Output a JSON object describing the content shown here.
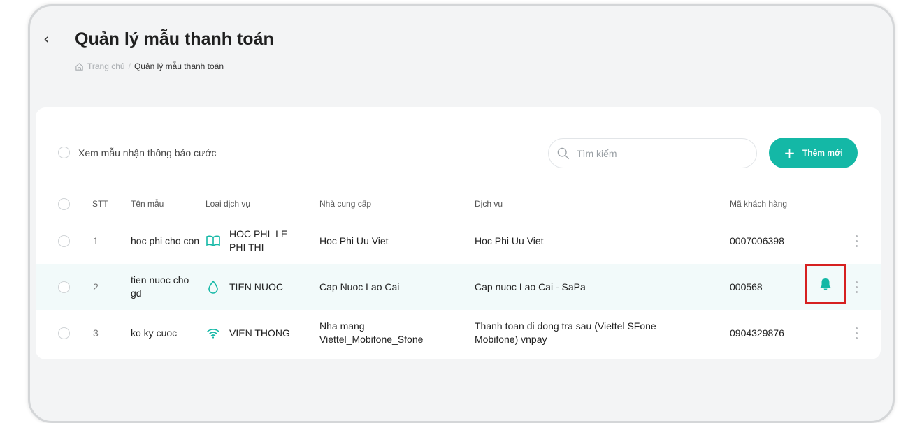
{
  "header": {
    "title": "Quản lý mẫu thanh toán",
    "breadcrumb": {
      "home": "Trang chủ",
      "separator": "/",
      "current": "Quản lý mẫu thanh toán"
    }
  },
  "toolbar": {
    "notice_toggle_label": "Xem mẫu nhận thông báo cước",
    "search_placeholder": "Tìm kiếm",
    "add_button_label": "Thêm mới"
  },
  "table": {
    "columns": [
      "STT",
      "Tên mẫu",
      "Loại dịch vụ",
      "Nhà cung cấp",
      "Dịch vụ",
      "Mã khách hàng"
    ],
    "rows": [
      {
        "stt": "1",
        "name": "hoc phi cho con",
        "service_type": "HOC PHI_LE PHI THI",
        "service_icon": "book-icon",
        "provider": "Hoc Phi Uu Viet",
        "service": "Hoc Phi Uu Viet",
        "customer_code": "0007006398"
      },
      {
        "stt": "2",
        "name": "tien nuoc cho gd",
        "service_type": "TIEN NUOC",
        "service_icon": "water-drop-icon",
        "provider": "Cap Nuoc Lao Cai",
        "service": "Cap nuoc Lao Cai - SaPa",
        "customer_code": "000568",
        "notification_icon": "bell-icon"
      },
      {
        "stt": "3",
        "name": "ko ky cuoc",
        "service_type": "VIEN THONG",
        "service_icon": "wifi-icon",
        "provider": "Nha mang Viettel_Mobifone_Sfone",
        "service": "Thanh toan di dong tra sau (Viettel SFone Mobifone) vnpay",
        "customer_code": "0904329876"
      }
    ]
  },
  "colors": {
    "accent": "#14b8a6",
    "highlight_border": "#d62020",
    "selected_row_bg": "#f2fafa"
  }
}
